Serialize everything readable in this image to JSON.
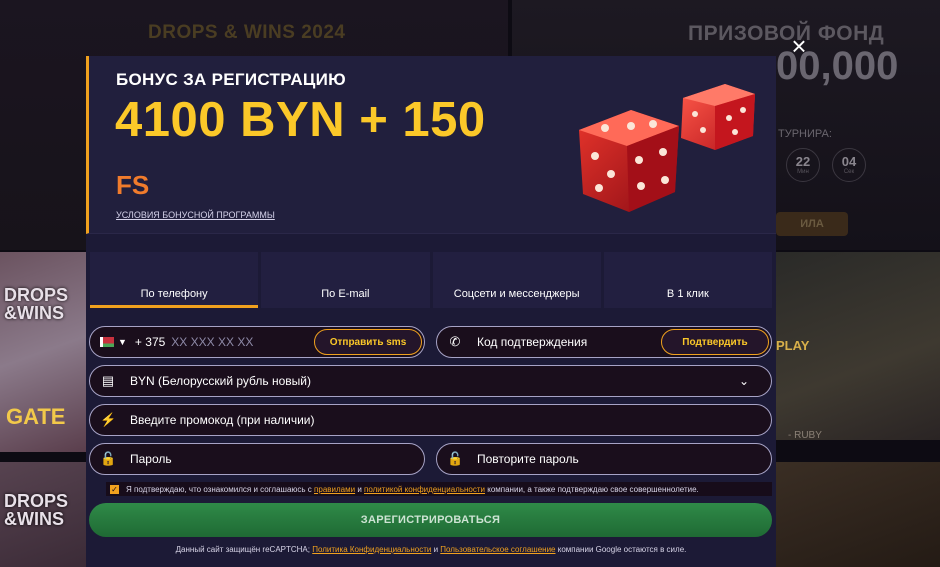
{
  "background": {
    "left_title": "DROPS & WINS 2024",
    "right_title": "ПРИЗОВОЙ ФОНД",
    "prize_amount": "00,000",
    "tournament_label": "ТУРНИРА:",
    "timer": [
      {
        "value": "22",
        "unit": "Мин"
      },
      {
        "value": "04",
        "unit": "Сек"
      }
    ],
    "rules_button": "ИЛА",
    "tile_text_1": "DROPS &WINS",
    "tile_text_2": "DROPS &WINS",
    "gate_text": "GATE",
    "play_text": "PLAY",
    "ruby_text": "- RUBY"
  },
  "modal": {
    "close_label": "×",
    "banner": {
      "subtitle": "БОНУС ЗА РЕГИСТРАЦИЮ",
      "amount": "4100 BYN + 150",
      "fs": "FS",
      "terms_link": "УСЛОВИЯ БОНУСНОЙ ПРОГРАММЫ"
    },
    "tabs": [
      {
        "label": "По телефону",
        "active": true
      },
      {
        "label": "По E-mail",
        "active": false
      },
      {
        "label": "Соцсети и мессенджеры",
        "active": false
      },
      {
        "label": "В 1 клик",
        "active": false
      }
    ],
    "phone": {
      "code": "+ 375",
      "placeholder": "XX XXX XX XX",
      "send_sms_button": "Отправить sms"
    },
    "confirmation": {
      "label": "Код подтверждения",
      "confirm_button": "Подтвердить"
    },
    "currency": {
      "selected": "BYN (Белорусский рубль новый)"
    },
    "promo": {
      "label": "Введите промокод (при наличии)"
    },
    "password": {
      "label": "Пароль",
      "repeat_label": "Повторите пароль"
    },
    "agreement": {
      "text_1": "Я подтверждаю, что ознакомился и соглашаюсь с",
      "rules_link": "правилами",
      "and": "и",
      "privacy_link": "политикой конфиденциальности",
      "text_2": "компании, а также подтверждаю свое совершеннолетие."
    },
    "register_button": "ЗАРЕГИСТРИРОВАТЬСЯ",
    "footer": {
      "text_1": "Данный сайт защищён reCAPTCHA;",
      "privacy_link": "Политика Конфиденциальности",
      "and": "и",
      "terms_link": "Пользовательское соглашение",
      "text_2": "компании Google остаются в силе."
    }
  },
  "colors": {
    "accent": "#f0a11e",
    "amount_yellow": "#fbc829",
    "fs_orange": "#f07b2c",
    "modal_bg": "#1c1a36",
    "register_green": "#2f8a48"
  }
}
